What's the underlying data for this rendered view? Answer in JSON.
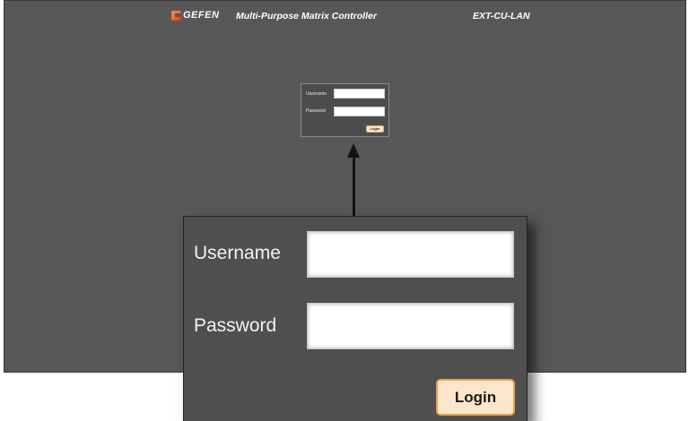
{
  "header": {
    "logo_text": "GEFEN",
    "app_title": "Multi-Purpose Matrix Controller",
    "device_name": "EXT-CU-LAN"
  },
  "login_form": {
    "username_label": "Username",
    "password_label": "Password",
    "username_value": "",
    "password_value": "",
    "login_button": "Login"
  },
  "colors": {
    "background": "#575757",
    "button_fill": "#fce6cb",
    "button_border": "#e8a24e",
    "logo_accent": "#e5321a"
  }
}
